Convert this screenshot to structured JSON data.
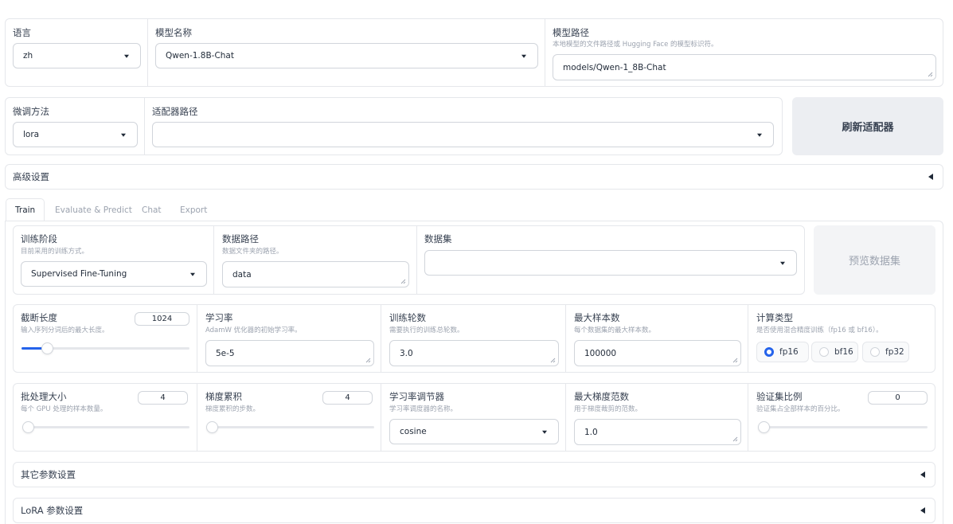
{
  "top": {
    "lang": {
      "label": "语言",
      "value": "zh"
    },
    "model_name": {
      "label": "模型名称",
      "value": "Qwen-1.8B-Chat"
    },
    "model_path": {
      "label": "模型路径",
      "info": "本地模型的文件路径或 Hugging Face 的模型标识符。",
      "value": "models/Qwen-1_8B-Chat"
    }
  },
  "row2": {
    "finetune": {
      "label": "微调方法",
      "value": "lora"
    },
    "adapter": {
      "label": "适配器路径",
      "value": ""
    },
    "refresh_button": "刷新适配器"
  },
  "advanced": {
    "title": "高级设置"
  },
  "tabs": [
    "Train",
    "Evaluate & Predict",
    "Chat",
    "Export"
  ],
  "train": {
    "stage": {
      "label": "训练阶段",
      "info": "目前采用的训练方式。",
      "value": "Supervised Fine-Tuning"
    },
    "dataset_dir": {
      "label": "数据路径",
      "info": "数据文件夹的路径。",
      "value": "data"
    },
    "dataset": {
      "label": "数据集",
      "value": ""
    },
    "preview_button": "预览数据集",
    "cutoff_len": {
      "label": "截断长度",
      "info": "输入序列分词后的最大长度。",
      "value": "1024",
      "slider_fraction": 0.15
    },
    "learning_rate": {
      "label": "学习率",
      "info": "AdamW 优化器的初始学习率。",
      "value": "5e-5"
    },
    "epochs": {
      "label": "训练轮数",
      "info": "需要执行的训练总轮数。",
      "value": "3.0"
    },
    "max_samples": {
      "label": "最大样本数",
      "info": "每个数据集的最大样本数。",
      "value": "100000"
    },
    "compute_type": {
      "label": "计算类型",
      "info": "是否使用混合精度训练（fp16 或 bf16）。",
      "options": [
        "fp16",
        "bf16",
        "fp32"
      ],
      "selected": "fp16"
    },
    "batch_size": {
      "label": "批处理大小",
      "info": "每个 GPU 处理的样本数量。",
      "value": "4",
      "slider_fraction": 0.0
    },
    "grad_accum": {
      "label": "梯度累积",
      "info": "梯度累积的步数。",
      "value": "4",
      "slider_fraction": 0.0
    },
    "lr_scheduler": {
      "label": "学习率调节器",
      "info": "学习率调度器的名称。",
      "value": "cosine"
    },
    "max_grad_norm": {
      "label": "最大梯度范数",
      "info": "用于梯度裁剪的范数。",
      "value": "1.0"
    },
    "val_size": {
      "label": "验证集比例",
      "info": "验证集占全部样本的百分比。",
      "value": "0",
      "slider_fraction": 0.0
    },
    "other_settings": "其它参数设置",
    "lora_settings": "LoRA 参数设置"
  },
  "colors": {
    "accent": "#2563eb",
    "border": "#e5e7eb"
  }
}
